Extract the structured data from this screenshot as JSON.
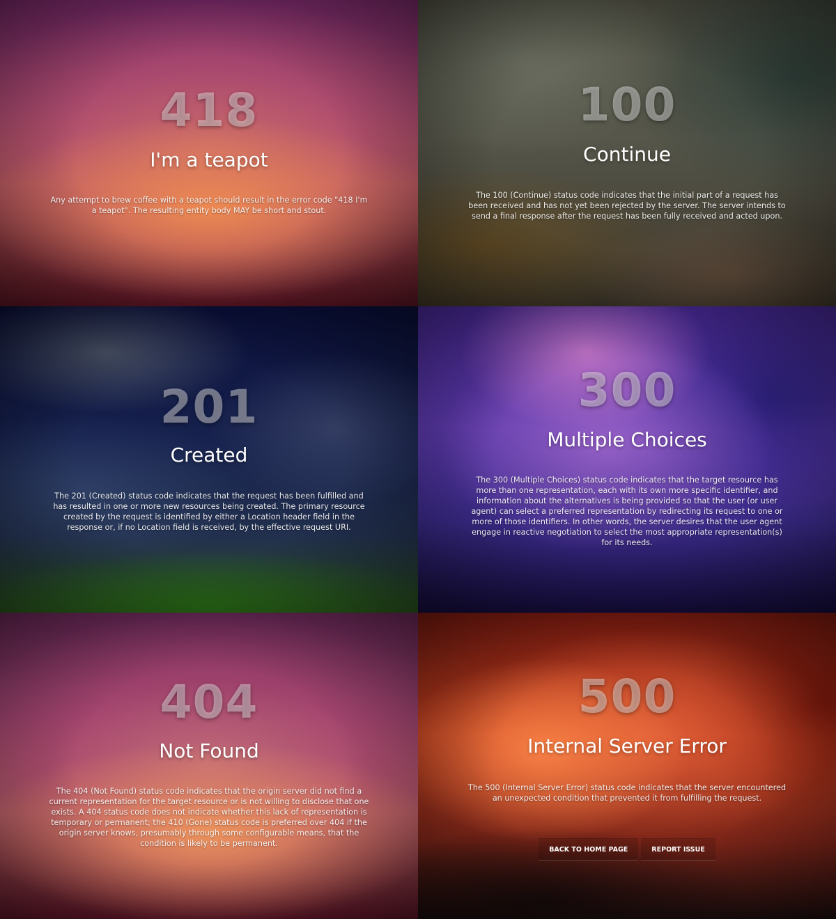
{
  "panels": [
    {
      "code": "418",
      "title": "I'm a teapot",
      "description": "Any attempt to brew coffee with a teapot should result in the error code \"418 I'm a teapot\". The resulting entity body MAY be short and stout."
    },
    {
      "code": "100",
      "title": "Continue",
      "description": "The 100 (Continue) status code indicates that the initial part of a request has been received and has not yet been rejected by the server. The server intends to send a final response after the request has been fully received and acted upon."
    },
    {
      "code": "201",
      "title": "Created",
      "description": "The 201 (Created) status code indicates that the request has been fulfilled and has resulted in one or more new resources being created. The primary resource created by the request is identified by either a Location header field in the response or, if no Location field is received, by the effective request URI."
    },
    {
      "code": "300",
      "title": "Multiple Choices",
      "description": "The 300 (Multiple Choices) status code indicates that the target resource has more than one representation, each with its own more specific identifier, and information about the alternatives is being provided so that the user (or user agent) can select a preferred representation by redirecting its request to one or more of those identifiers. In other words, the server desires that the user agent engage in reactive negotiation to select the most appropriate representation(s) for its needs."
    },
    {
      "code": "404",
      "title": "Not Found",
      "description": "The 404 (Not Found) status code indicates that the origin server did not find a current representation for the target resource or is not willing to disclose that one exists. A 404 status code does not indicate whether this lack of representation is temporary or permanent; the 410 (Gone) status code is preferred over 404 if the origin server knows, presumably through some configurable means, that the condition is likely to be permanent."
    },
    {
      "code": "500",
      "title": "Internal Server Error",
      "description": "The 500 (Internal Server Error) status code indicates that the server encountered an unexpected condition that prevented it from fulfilling the request.",
      "buttons": {
        "home": "Back to home page",
        "report": "Report issue"
      }
    }
  ]
}
